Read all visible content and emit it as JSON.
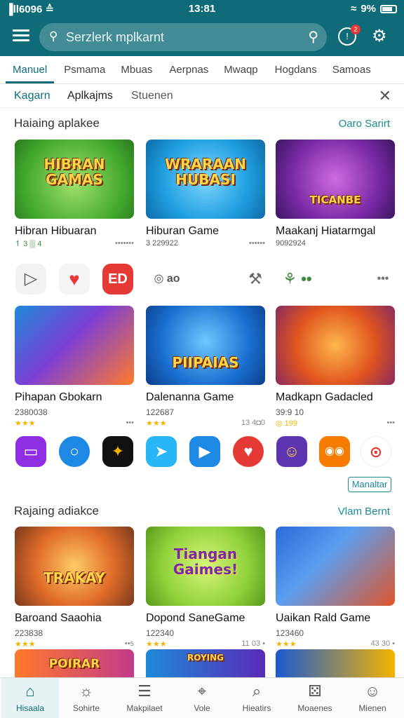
{
  "status": {
    "carrier": "▐ll6096 ≙",
    "time": "13:81",
    "battery": "9%"
  },
  "search": {
    "placeholder": "Serzlerk mplkarnt"
  },
  "notifications": {
    "count": "2"
  },
  "colors": {
    "primary": "#0f6b78",
    "accent": "#1a8a96",
    "star": "#f4b400"
  },
  "categories": [
    {
      "label": "Manuel"
    },
    {
      "label": "Psmama"
    },
    {
      "label": "Mbuas"
    },
    {
      "label": "Aerpnas"
    },
    {
      "label": "Mwaqp"
    },
    {
      "label": "Hogdans"
    },
    {
      "label": "Samoas"
    }
  ],
  "subtabs": [
    "Kagarn",
    "Aplkajms",
    "Stuenen"
  ],
  "section1": {
    "title": "Haiaing aplakee",
    "link": "Oaro Sarirt"
  },
  "section2": {
    "title": "Rajaing adiakce",
    "link": "Vlam Bernt"
  },
  "more_button": "Manaltar",
  "cards_row1": [
    {
      "title": "Hibran Hibuaran",
      "meta": "↿ 3 ▒ 4",
      "extra": "•••••••",
      "art": "HIBRAN GAMAS",
      "icon": "game-art-icon"
    },
    {
      "title": "Hiburan Game",
      "meta": "3 229922",
      "extra": "••••••",
      "art": "WRARAAN HUBASI",
      "icon": "game-art-icon"
    },
    {
      "title": "Maakanj Hiatarmgal",
      "meta": "9092924",
      "extra": "",
      "art": "TICANBE",
      "icon": "game-art-icon"
    }
  ],
  "action_icons": [
    {
      "glyph": "▷",
      "icon": "play-icon"
    },
    {
      "glyph": "♥",
      "icon": "heart-icon"
    },
    {
      "glyph": "ED",
      "icon": "ed-app-icon"
    },
    {
      "glyph": "◎ ao",
      "icon": "basketball-icon"
    },
    {
      "glyph": "⚒",
      "icon": "tools-icon"
    },
    {
      "glyph": "⚘ ••",
      "icon": "plant-icon"
    },
    {
      "glyph": "•••",
      "icon": "more-icon"
    }
  ],
  "cards_row2": [
    {
      "title": "Pihapan Gbokarn",
      "meta": "2380038",
      "stars": "★★★",
      "extra": "•••",
      "art": "",
      "icon": "game-art-icon"
    },
    {
      "title": "Dalenanna Game",
      "meta": "122687",
      "stars": "★★★",
      "extra": "13 4◘0",
      "art": "PIIPAIAS",
      "icon": "game-art-icon"
    },
    {
      "title": "Madkapn Gadacled",
      "meta": "39:9 10",
      "stars": "◎ 199",
      "extra": "•••",
      "art": "",
      "icon": "game-art-icon"
    }
  ],
  "app_icons": [
    {
      "glyph": "▭",
      "icon": "wallet-app-icon",
      "color": "#8e2de2"
    },
    {
      "glyph": "○",
      "icon": "chat-app-icon",
      "color": "#1e88e5"
    },
    {
      "glyph": "✦",
      "icon": "gold-app-icon",
      "color": "#111111"
    },
    {
      "glyph": "➤",
      "icon": "send-app-icon",
      "color": "#29b6f6"
    },
    {
      "glyph": "▶",
      "icon": "video-app-icon",
      "color": "#1e88e5"
    },
    {
      "glyph": "♥",
      "icon": "love-app-icon",
      "color": "#e53935"
    },
    {
      "glyph": "☺",
      "icon": "face-app-icon",
      "color": "#5e35b1"
    },
    {
      "glyph": "◉◉",
      "icon": "eyes-app-icon",
      "color": "#f57c00"
    },
    {
      "glyph": "⊙",
      "icon": "red-app-icon",
      "color": "#e53935"
    }
  ],
  "cards_row3": [
    {
      "title": "Baroand Saaohia",
      "meta": "223838",
      "stars": "★★★",
      "extra": "••s",
      "art": "TRAKAY",
      "icon": "game-art-icon"
    },
    {
      "title": "Dopond SaneGame",
      "meta": "122340",
      "stars": "★★★",
      "extra": "11 03 •",
      "art": "Tiangan Gaimes!",
      "icon": "game-art-icon"
    },
    {
      "title": "Uaikan Rald Game",
      "meta": "123460",
      "stars": "★★★",
      "extra": "43 30 •",
      "art": "",
      "icon": "game-art-icon"
    }
  ],
  "cards_row4": [
    {
      "art": "POIRAR"
    },
    {
      "art": "ROYING"
    },
    {
      "art": ""
    }
  ],
  "bottom_nav": [
    {
      "label": "Hisaala",
      "glyph": "⌂",
      "icon": "home-icon"
    },
    {
      "label": "Sohirte",
      "glyph": "☼",
      "icon": "search-icon"
    },
    {
      "label": "Makpilaet",
      "glyph": "☰",
      "icon": "market-icon"
    },
    {
      "label": "Vole",
      "glyph": "⌖",
      "icon": "vote-icon"
    },
    {
      "label": "Hieatirs",
      "glyph": "⌕",
      "icon": "discover-icon"
    },
    {
      "label": "Moaenes",
      "glyph": "⚄",
      "icon": "games-icon"
    },
    {
      "label": "Mienen",
      "glyph": "☺",
      "icon": "profile-icon"
    }
  ]
}
